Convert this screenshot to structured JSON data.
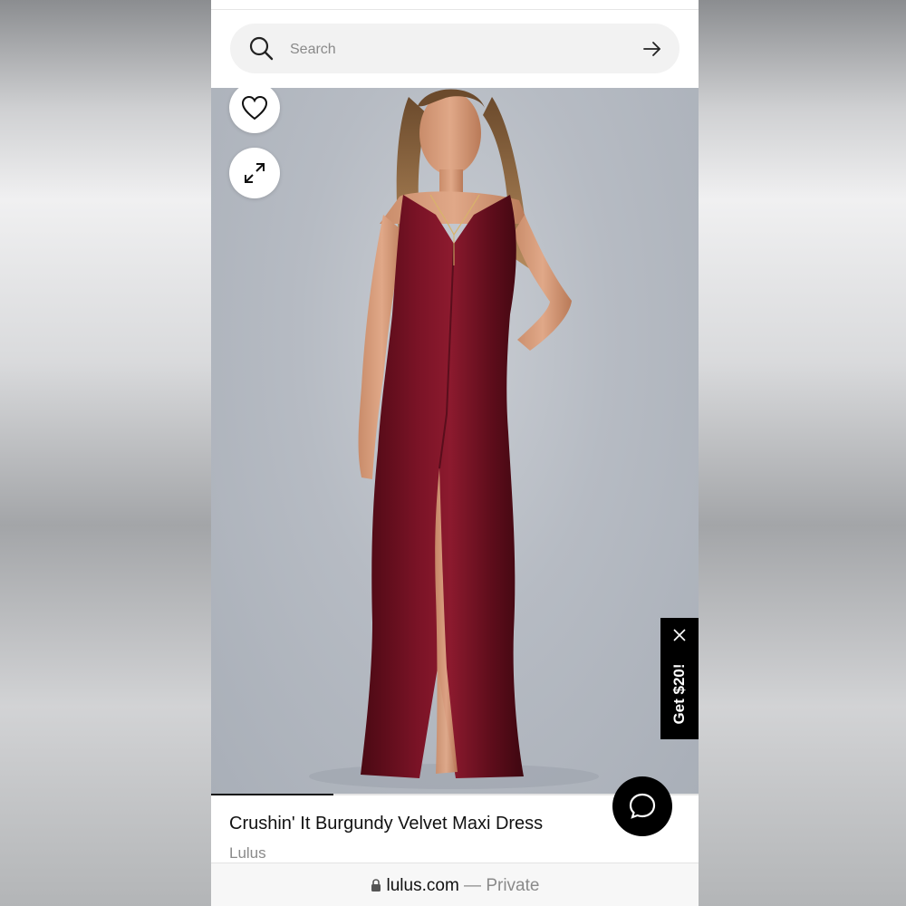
{
  "search": {
    "placeholder": "Search"
  },
  "product": {
    "title": "Crushin' It Burgundy Velvet Maxi Dress",
    "brand": "Lulus"
  },
  "promo": {
    "label": "Get $20!"
  },
  "gallery": {
    "progress": 0.25
  },
  "browser": {
    "domain": "lulus.com",
    "separator": " — ",
    "mode": "Private"
  },
  "colors": {
    "dress": "#6e0f1f",
    "accent": "#000000",
    "search_bg": "#f2f2f2"
  },
  "icons": [
    "search-icon",
    "arrow-right-icon",
    "heart-icon",
    "expand-icon",
    "close-icon",
    "chat-icon",
    "lock-icon"
  ]
}
